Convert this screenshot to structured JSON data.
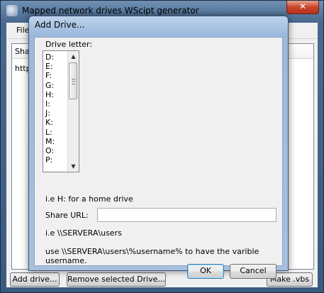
{
  "main_window": {
    "title": "Mapped network drives WScipt generator",
    "close_glyph": "✕",
    "menu_file": "File",
    "list_header": "Share",
    "list_row": "http:",
    "add_drive_button": "Add drive...",
    "remove_button": "Remove selected Drive...",
    "make_vbs_button": "Make .vbs"
  },
  "dialog": {
    "title": "Add Drive...",
    "drive_letter_label": "Drive letter:",
    "drives": [
      "D:",
      "E:",
      "F:",
      "G:",
      "H:",
      "I:",
      "J:",
      "K:",
      "L:",
      "M:",
      "O:",
      "P:"
    ],
    "scroll_up": "▲",
    "scroll_down": "▼",
    "hint_home": "i.e H: for a home drive",
    "share_url_label": "Share URL:",
    "share_url_value": "",
    "hint_url": "i.e \\\\SERVERA\\users",
    "hint_username": "use \\\\SERVERA\\users\\%username% to have the varible username.",
    "ok_label": "OK",
    "cancel_label": "Cancel"
  }
}
